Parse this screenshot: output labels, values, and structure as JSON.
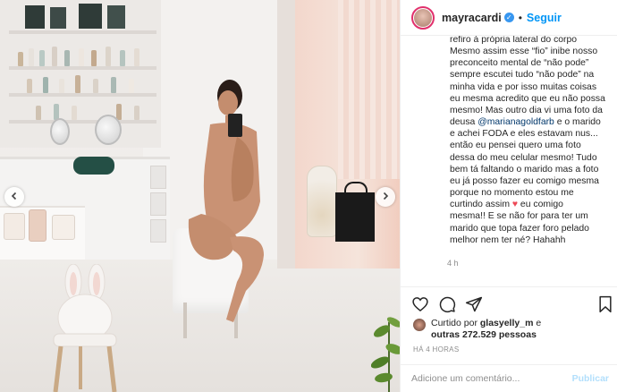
{
  "header": {
    "username": "mayracardi",
    "separator": "•",
    "follow_label": "Seguir"
  },
  "caption": {
    "line1": "refiro à própria lateral do corpo",
    "line2": "Mesmo assim esse “fio” inibe nosso",
    "line3": "preconceito mental de “não pode”",
    "line4": "sempre escutei tudo “não pode” na",
    "line5": "minha vida e por isso muitas coisas",
    "line6": "eu mesma acredito que eu não possa",
    "line7": "mesmo! Mas outro dia vi uma foto da",
    "line8_prefix": "deusa ",
    "mention": "@marianagoldfarb",
    "line8_suffix": " e o marido",
    "line9": "e achei FODA e eles estavam nus...",
    "line10": "então eu pensei quero uma foto",
    "line11": "dessa do meu celular mesmo! Tudo",
    "line12": "bem tá faltando o marido mas a foto",
    "line13": "eu já posso fazer eu comigo mesma",
    "line14": "porque no momento estou me",
    "line15_prefix": "curtindo assim ",
    "heart": "♥",
    "line15_suffix": " eu comigo",
    "line16": "mesma!! E se não for para ter um",
    "line17": "marido que topa fazer foro pelado",
    "line18": "melhor nem ter né? Hahahh",
    "time_ago": "4 h"
  },
  "likes": {
    "prefix": "Curtido por ",
    "by_user": "glasyelly_m",
    "connector": " e",
    "others": "outras 272.529 pessoas",
    "posted_ago": "HÁ 4 HORAS"
  },
  "comment": {
    "placeholder": "Adicione um comentário...",
    "publish_label": "Publicar"
  },
  "colors": {
    "accent_blue": "#0095f6",
    "mention": "#00376b",
    "heart": "#ed4956",
    "muted": "#8e8e8e"
  },
  "icons": {
    "like": "heart-outline-icon",
    "comment": "comment-bubble-icon",
    "share": "paper-plane-icon",
    "save": "bookmark-icon",
    "prev": "chevron-left-icon",
    "next": "chevron-right-icon"
  }
}
